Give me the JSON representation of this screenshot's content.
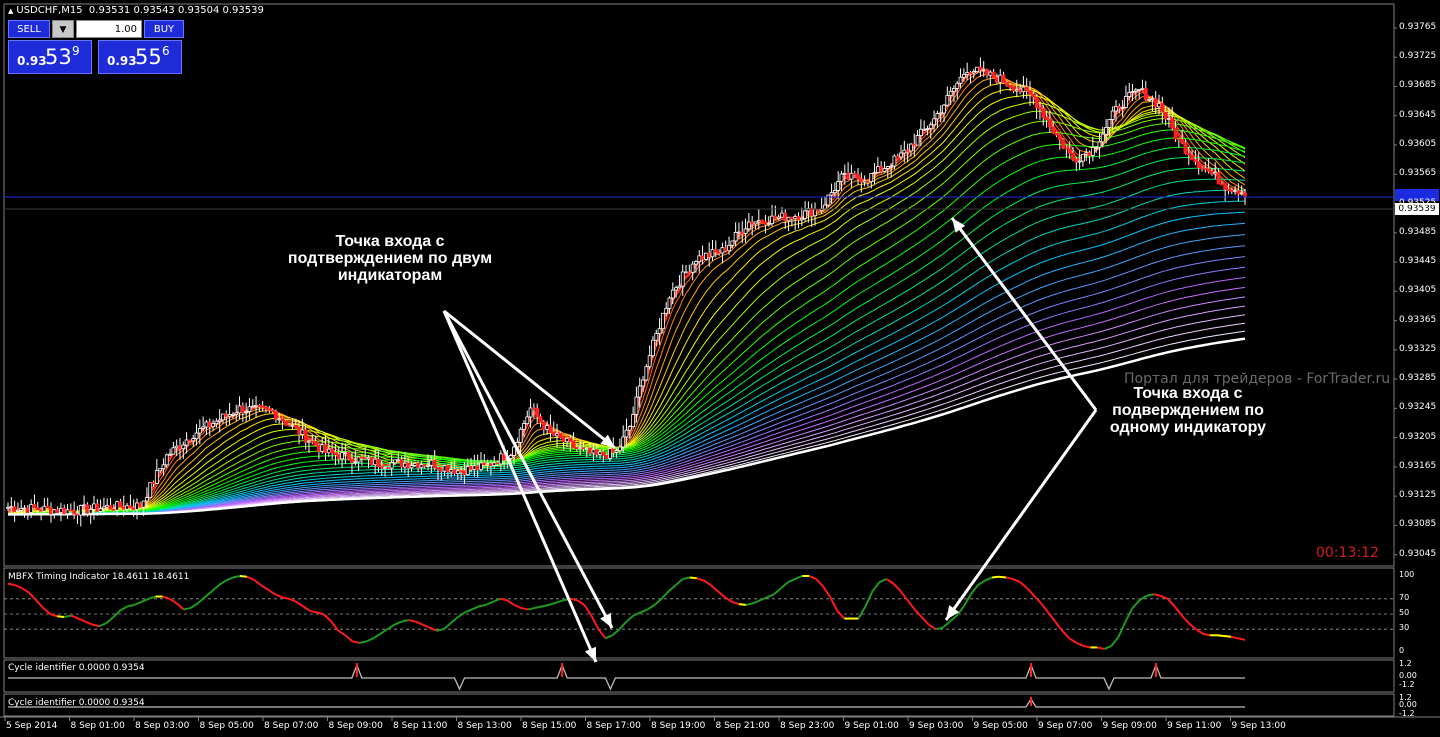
{
  "header": {
    "symbol": "USDCHF,M15",
    "ohlc": "0.93531 0.93543 0.93504 0.93539"
  },
  "trade_panel": {
    "sell_label": "SELL",
    "buy_label": "BUY",
    "lot": "1.00",
    "sell_prefix": "0.93",
    "sell_big": "53",
    "sell_sup": "9",
    "buy_prefix": "0.93",
    "buy_big": "55",
    "buy_sup": "6"
  },
  "annotations": {
    "left": "Точка входа с подтверждением по двум индикаторам",
    "right": "Точка входа с подверждением по одному индикатору"
  },
  "watermark": "Портал для трейдеров - ForTrader.ru",
  "timer": "00:13:12",
  "current_price": {
    "bid": "0.93539",
    "line": "0.93560"
  },
  "colors": {
    "background": "#000000",
    "bull_candle": "#ffffff",
    "bear_candle": "#ff2020",
    "button": "#1e2bd8",
    "timer": "#d41c1c",
    "price_line": "#1b2be0"
  },
  "chart_data": [
    {
      "type": "candlestick",
      "title": "USDCHF,M15",
      "ylim": [
        0.93035,
        0.93795
      ],
      "y_ticks": [
        "0.93765",
        "0.93725",
        "0.93685",
        "0.93645",
        "0.93605",
        "0.93565",
        "0.93525",
        "0.93485",
        "0.93445",
        "0.93405",
        "0.93365",
        "0.93325",
        "0.93285",
        "0.93245",
        "0.93205",
        "0.93165",
        "0.93125",
        "0.93085",
        "0.93045"
      ],
      "x_ticks": [
        "5 Sep 2014",
        "8 Sep 01:00",
        "8 Sep 03:00",
        "8 Sep 05:00",
        "8 Sep 07:00",
        "8 Sep 09:00",
        "8 Sep 11:00",
        "8 Sep 13:00",
        "8 Sep 15:00",
        "8 Sep 17:00",
        "8 Sep 19:00",
        "8 Sep 21:00",
        "8 Sep 23:00",
        "9 Sep 01:00",
        "9 Sep 03:00",
        "9 Sep 05:00",
        "9 Sep 07:00",
        "9 Sep 09:00",
        "9 Sep 11:00",
        "9 Sep 13:00"
      ],
      "close_path": [
        [
          0,
          0.9311
        ],
        [
          20,
          0.93105
        ],
        [
          30,
          0.9311
        ],
        [
          40,
          0.93112
        ],
        [
          48,
          0.9318
        ],
        [
          56,
          0.9321
        ],
        [
          64,
          0.9323
        ],
        [
          70,
          0.93245
        ],
        [
          80,
          0.9324
        ],
        [
          96,
          0.93185
        ],
        [
          112,
          0.9317
        ],
        [
          128,
          0.9317
        ],
        [
          136,
          0.9316
        ],
        [
          144,
          0.93165
        ],
        [
          152,
          0.93185
        ],
        [
          158,
          0.93245
        ],
        [
          164,
          0.9321
        ],
        [
          172,
          0.9319
        ],
        [
          178,
          0.9318
        ],
        [
          184,
          0.93185
        ],
        [
          188,
          0.9322
        ],
        [
          192,
          0.9329
        ],
        [
          200,
          0.934
        ],
        [
          208,
          0.9345
        ],
        [
          216,
          0.9346
        ],
        [
          224,
          0.935
        ],
        [
          232,
          0.93505
        ],
        [
          240,
          0.9351
        ],
        [
          246,
          0.9352
        ],
        [
          252,
          0.9356
        ],
        [
          260,
          0.9356
        ],
        [
          270,
          0.9359
        ],
        [
          280,
          0.9364
        ],
        [
          290,
          0.9371
        ],
        [
          300,
          0.93695
        ],
        [
          310,
          0.9367
        ],
        [
          316,
          0.93625
        ],
        [
          322,
          0.93585
        ],
        [
          328,
          0.936
        ],
        [
          336,
          0.9366
        ],
        [
          342,
          0.9368
        ],
        [
          348,
          0.9366
        ],
        [
          354,
          0.9361
        ],
        [
          360,
          0.9358
        ],
        [
          368,
          0.9355
        ],
        [
          374,
          0.9354
        ]
      ],
      "ema_fan": {
        "count": 34,
        "colors": [
          "#ff1a1a",
          "#ffff00",
          "#00ff00",
          "#00c8ff",
          "#c060ff",
          "#ffffff"
        ]
      }
    },
    {
      "type": "line",
      "title": "MBFX Timing Indicator 18.4611 18.4611",
      "ylim": [
        0,
        100
      ],
      "y_ticks": [
        "100",
        "70",
        "50",
        "30",
        "0"
      ],
      "levels": [
        100,
        70,
        50,
        30,
        0
      ],
      "values": [
        90,
        88,
        84,
        78,
        68,
        58,
        50,
        47,
        46,
        48,
        44,
        40,
        36,
        34,
        38,
        46,
        55,
        60,
        62,
        66,
        70,
        73,
        73,
        70,
        64,
        56,
        58,
        64,
        72,
        80,
        88,
        94,
        98,
        100,
        99,
        95,
        88,
        82,
        76,
        72,
        70,
        66,
        60,
        54,
        52,
        49,
        40,
        28,
        22,
        14,
        12,
        14,
        18,
        24,
        30,
        36,
        40,
        42,
        40,
        36,
        32,
        28,
        30,
        38,
        46,
        52,
        56,
        60,
        62,
        66,
        70,
        68,
        62,
        58,
        56,
        58,
        60,
        62,
        65,
        68,
        70,
        68,
        62,
        48,
        30,
        18,
        22,
        30,
        40,
        48,
        52,
        56,
        62,
        70,
        80,
        88,
        96,
        98,
        97,
        94,
        88,
        80,
        72,
        66,
        63,
        62,
        64,
        68,
        72,
        76,
        84,
        92,
        96,
        100,
        100,
        96,
        86,
        72,
        54,
        44,
        44,
        44,
        60,
        80,
        92,
        96,
        90,
        80,
        68,
        56,
        46,
        36,
        30,
        32,
        40,
        48,
        60,
        76,
        88,
        94,
        98,
        99,
        98,
        96,
        92,
        84,
        74,
        64,
        52,
        40,
        28,
        18,
        12,
        8,
        6,
        6,
        4,
        8,
        20,
        40,
        58,
        68,
        74,
        76,
        74,
        70,
        60,
        48,
        38,
        30,
        24,
        22,
        22,
        21,
        20,
        18,
        16
      ]
    },
    {
      "type": "line",
      "title": "Cycle identifier 0.0000 0.9354",
      "y_ticks": [
        "1.2",
        "0.00",
        "-1.2"
      ],
      "peaks": [
        0.282,
        0.448,
        0.827,
        0.928
      ],
      "troughs": [
        0.365,
        0.487,
        0.89
      ]
    },
    {
      "type": "line",
      "title": "Cycle identifier 0.0000 0.9354",
      "y_ticks": [
        "1.2",
        "0.00",
        "-1.2"
      ],
      "peaks": [
        0.827
      ]
    }
  ]
}
